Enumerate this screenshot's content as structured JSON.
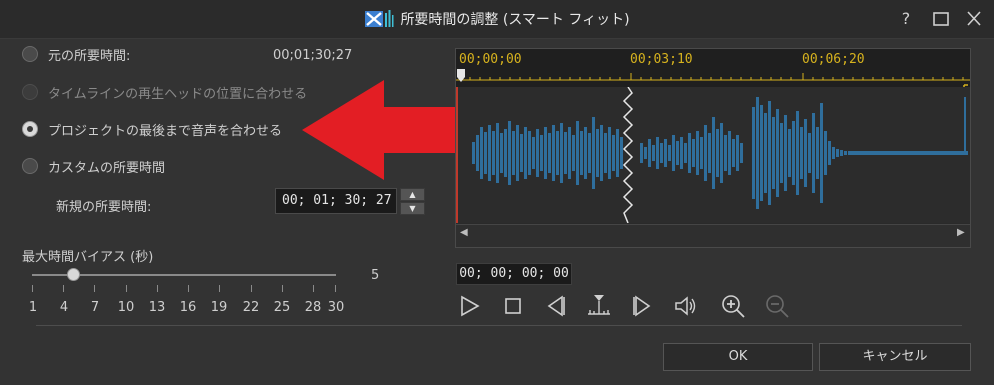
{
  "window": {
    "title": "所要時間の調整 (スマート フィット)",
    "help_label": "?",
    "app_icon": "powerdirector-icon",
    "buttons": [
      "help-icon",
      "maximize-icon",
      "close-icon"
    ]
  },
  "duration_options": [
    {
      "label": "元の所要時間:",
      "selected": false,
      "disabled": false
    },
    {
      "label": "タイムラインの再生ヘッドの位置に合わせる",
      "selected": false,
      "disabled": true
    },
    {
      "label": "プロジェクトの最後まで音声を合わせる",
      "selected": true,
      "disabled": false
    },
    {
      "label": "カスタムの所要時間",
      "selected": false,
      "disabled": false
    }
  ],
  "original_duration": "00;01;30;27",
  "new_duration": {
    "label": "新規の所要時間:",
    "value": "00; 01; 30; 27"
  },
  "bias": {
    "label": "最大時間バイアス (秒)",
    "value": "5",
    "ticks": [
      "1",
      "4",
      "7",
      "10",
      "13",
      "16",
      "19",
      "22",
      "25",
      "28",
      "30"
    ]
  },
  "timeline": {
    "ruler_times": [
      "00;00;00",
      "00;03;10",
      "00;06;20"
    ],
    "current_timecode": "00; 00; 00; 00"
  },
  "playback_controls": [
    "play-icon",
    "stop-icon",
    "previous-frame-icon",
    "trim-marker-icon",
    "next-frame-icon",
    "volume-icon",
    "zoom-in-icon",
    "zoom-out-icon"
  ],
  "dialog_buttons": {
    "ok": "OK",
    "cancel": "キャンセル"
  },
  "colors": {
    "annotation_arrow": "#e31e24",
    "waveform": "#2f6e9c",
    "ruler_text": "#d6b21e"
  }
}
